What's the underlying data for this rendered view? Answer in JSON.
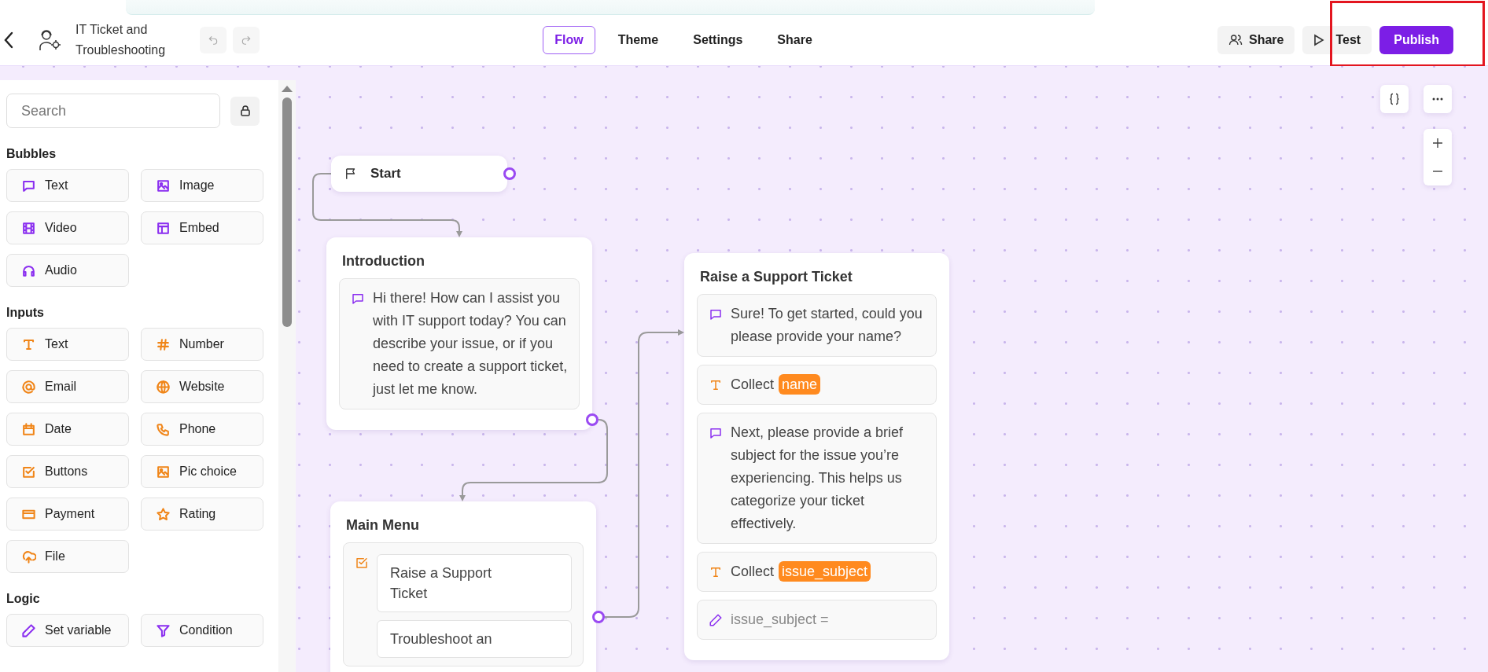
{
  "header": {
    "project_title": "IT Ticket and Troubleshooting",
    "tabs": [
      {
        "label": "Flow",
        "selected": true
      },
      {
        "label": "Theme",
        "selected": false
      },
      {
        "label": "Settings",
        "selected": false
      },
      {
        "label": "Share",
        "selected": false
      }
    ],
    "share_button": "Share",
    "test_button": "Test",
    "publish_button": "Publish"
  },
  "sidebar": {
    "search": {
      "placeholder": "Search"
    },
    "sections": [
      {
        "title": "Bubbles",
        "color": "#8b2ff0",
        "items": [
          {
            "label": "Text",
            "kind": "chat"
          },
          {
            "label": "Image",
            "kind": "image"
          },
          {
            "label": "Video",
            "kind": "video"
          },
          {
            "label": "Embed",
            "kind": "embed"
          },
          {
            "label": "Audio",
            "kind": "audio"
          }
        ]
      },
      {
        "title": "Inputs",
        "color": "#f08518",
        "items": [
          {
            "label": "Text",
            "kind": "text"
          },
          {
            "label": "Number",
            "kind": "number"
          },
          {
            "label": "Email",
            "kind": "email"
          },
          {
            "label": "Website",
            "kind": "website"
          },
          {
            "label": "Date",
            "kind": "date"
          },
          {
            "label": "Phone",
            "kind": "phone"
          },
          {
            "label": "Buttons",
            "kind": "buttons"
          },
          {
            "label": "Pic choice",
            "kind": "image"
          },
          {
            "label": "Payment",
            "kind": "payment"
          },
          {
            "label": "Rating",
            "kind": "rating"
          },
          {
            "label": "File",
            "kind": "file"
          }
        ]
      },
      {
        "title": "Logic",
        "color": "#8b2ff0",
        "items": [
          {
            "label": "Set variable",
            "kind": "pen"
          },
          {
            "label": "Condition",
            "kind": "condition"
          }
        ]
      }
    ]
  },
  "canvas": {
    "nodes": [
      {
        "kind": "start",
        "label": "Start"
      },
      {
        "kind": "group",
        "title": "Introduction",
        "blocks": [
          {
            "kind": "message",
            "text": "Hi there! How can I assist you with IT support today? You can describe your issue, or if you need to create a support ticket, just let me know."
          }
        ]
      },
      {
        "kind": "group",
        "title": "Main Menu",
        "blocks": [
          {
            "kind": "buttons",
            "choices": [
              "Raise a Support Ticket",
              "Troubleshoot an"
            ]
          }
        ]
      },
      {
        "kind": "group",
        "title": "Raise a Support Ticket",
        "blocks": [
          {
            "kind": "message",
            "text": "Sure! To get started, could you please provide your name?"
          },
          {
            "kind": "collect",
            "label": "Collect",
            "variable": "name"
          },
          {
            "kind": "message",
            "text": "Next, please provide a brief subject for the issue you’re experiencing. This helps us categorize your ticket effectively."
          },
          {
            "kind": "collect",
            "label": "Collect",
            "variable": "issue_subject"
          },
          {
            "kind": "set_variable",
            "text": "issue_subject ="
          }
        ]
      }
    ]
  }
}
